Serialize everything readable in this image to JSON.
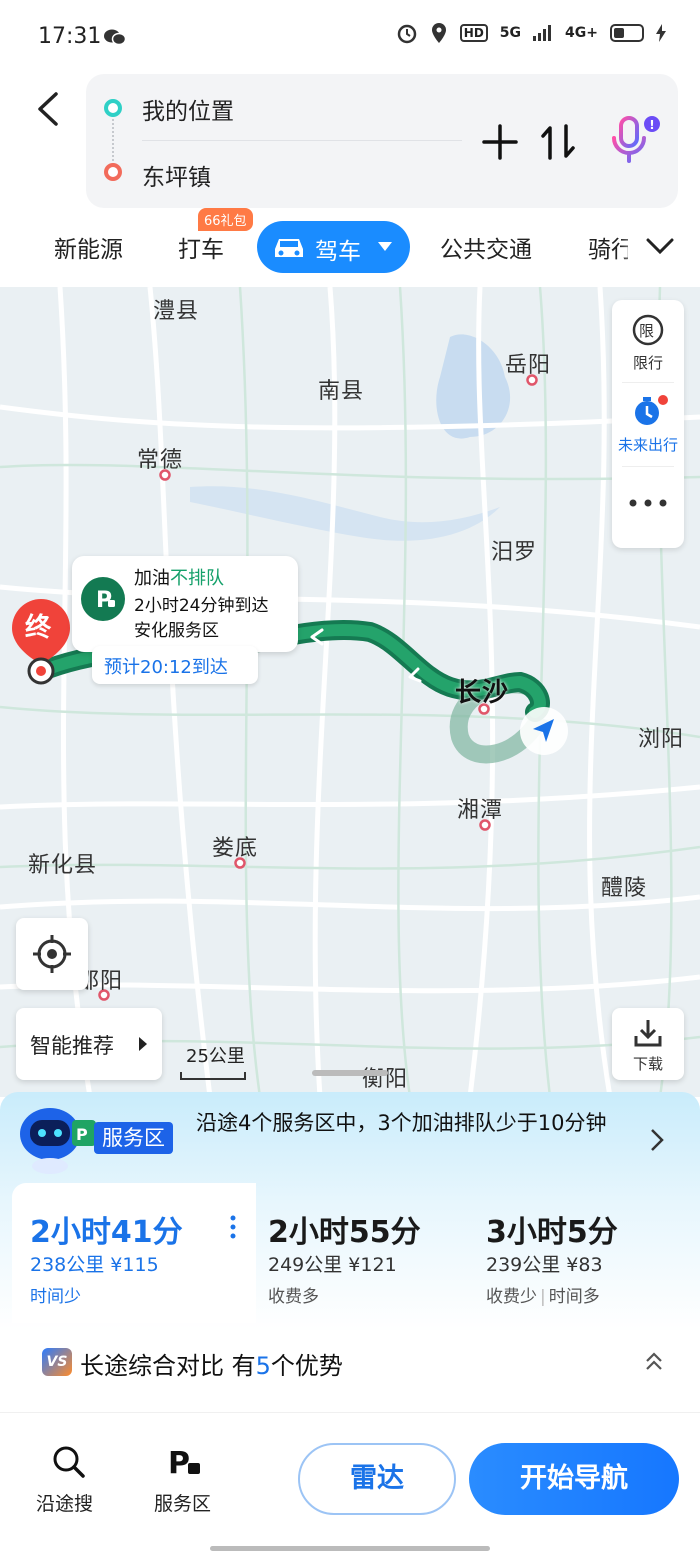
{
  "status_bar": {
    "time": "17:31",
    "network_5g": "5G",
    "network_4g": "4G+",
    "hd": "HD"
  },
  "route": {
    "from": "我的位置",
    "to": "东坪镇"
  },
  "tabs": [
    {
      "label": "新能源"
    },
    {
      "label": "打车",
      "badge": "66礼包"
    },
    {
      "label": "驾车",
      "active": true
    },
    {
      "label": "公共交通"
    },
    {
      "label": "骑行"
    }
  ],
  "map": {
    "cities": [
      "澧县",
      "岳阳",
      "南县",
      "常德",
      "汨罗",
      "长沙",
      "浏阳",
      "湘潭",
      "娄底",
      "新化县",
      "醴陵",
      "邵阳",
      "衡阳"
    ],
    "side_panel": {
      "restrict": "限行",
      "future": "未来出行",
      "restrict_icon": "限"
    },
    "destination_marker": "终",
    "info": {
      "title_prefix": "加油",
      "title_highlight": "不排队",
      "arrive": "2小时24分钟到达",
      "place": "安化服务区"
    },
    "eta": "预计20:12到达",
    "smart_recommend": "智能推荐",
    "scale": "25公里",
    "download": "下载"
  },
  "service_banner": {
    "tag": "服务区",
    "text": "沿途4个服务区中，3个加油排队少于10分钟"
  },
  "routes": [
    {
      "time": "2小时41分",
      "dist": "238公里 ¥115",
      "tag": "时间少",
      "selected": true
    },
    {
      "time": "2小时55分",
      "dist": "249公里 ¥121",
      "tag": "收费多"
    },
    {
      "time": "3小时5分",
      "dist": "239公里 ¥83",
      "tag": "收费少",
      "tag2": "时间多"
    }
  ],
  "compare": {
    "prefix": "长途综合对比 有",
    "count": "5",
    "suffix": "个优势",
    "vs": "VS"
  },
  "bottom": {
    "search_along": "沿途搜",
    "service_area": "服务区",
    "radar": "雷达",
    "start_nav": "开始导航"
  },
  "colors": {
    "accent": "#1a8cff",
    "route_green": "#1e8a5a",
    "route_alt": "#7fb5a0",
    "highlight_green": "#14a06a"
  }
}
